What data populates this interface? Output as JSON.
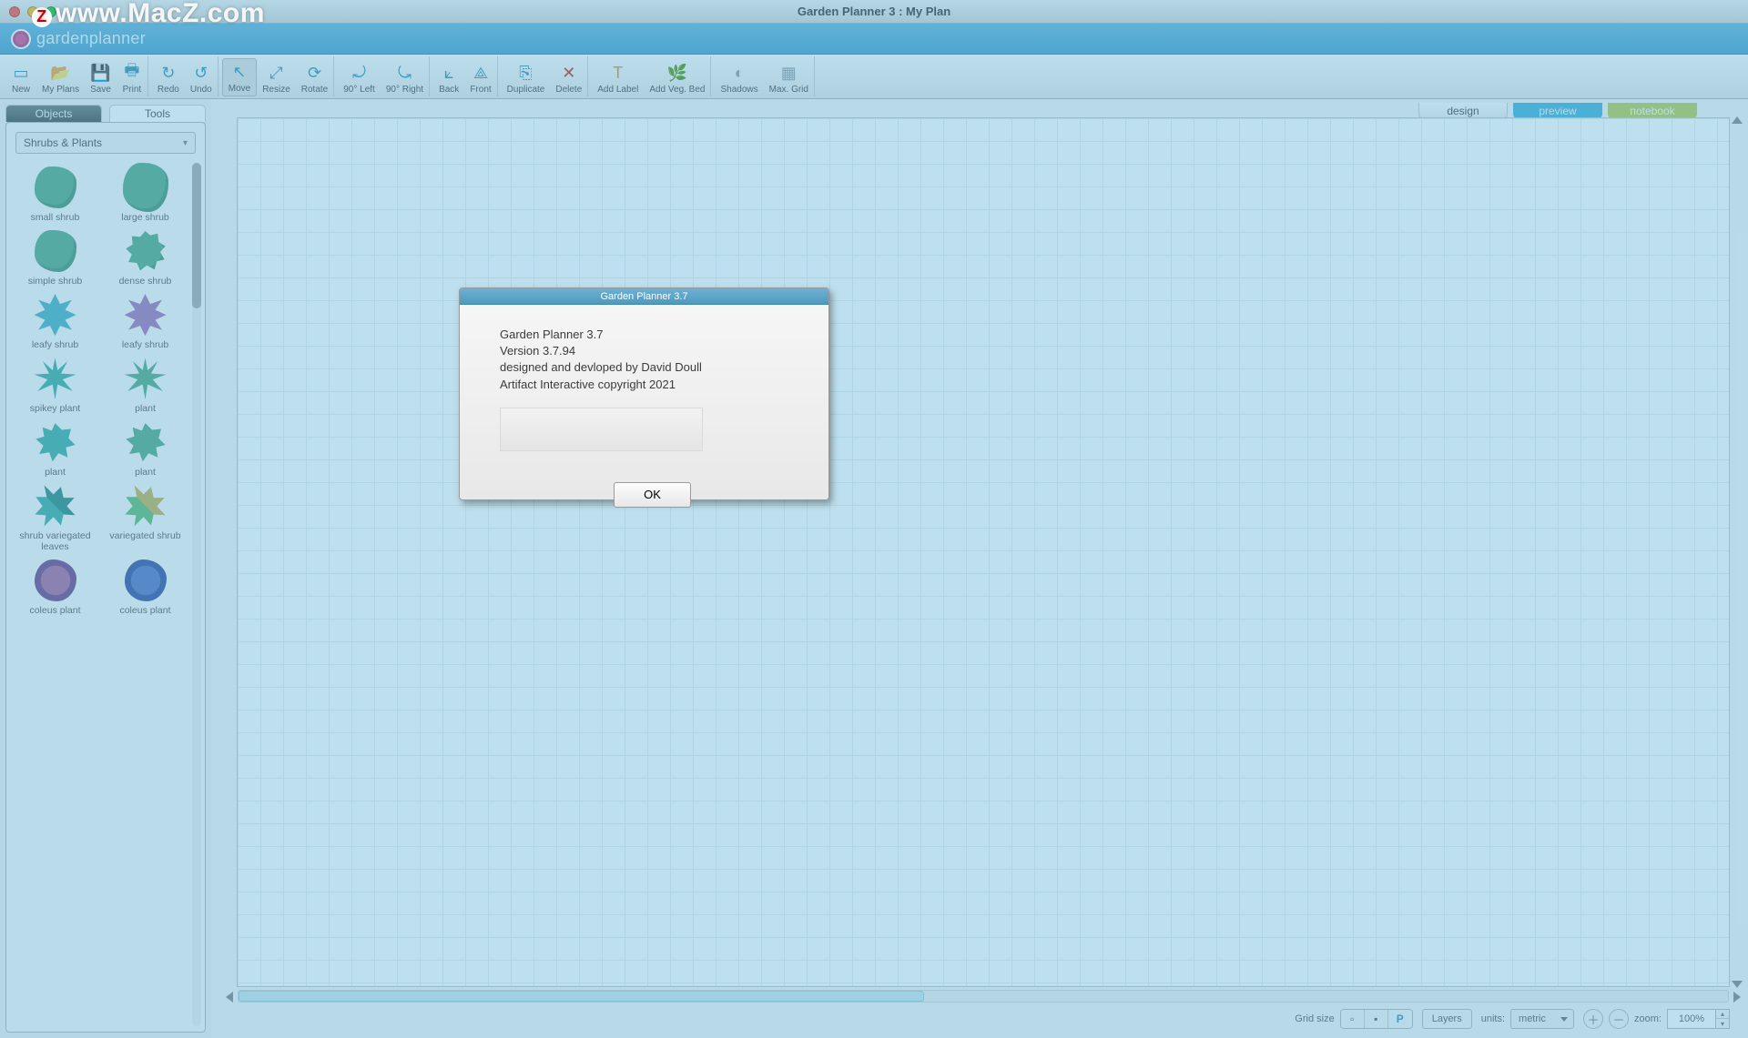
{
  "watermark": "www.MacZ.com",
  "window": {
    "title": "Garden Planner 3 : My  Plan"
  },
  "brand": {
    "name": "gardenplanner"
  },
  "toolbar": {
    "groups": [
      {
        "items": [
          {
            "id": "new",
            "label": "New",
            "icon": "▭"
          },
          {
            "id": "myplans",
            "label": "My Plans",
            "icon": "📂"
          },
          {
            "id": "save",
            "label": "Save",
            "icon": "💾"
          },
          {
            "id": "print",
            "label": "Print",
            "icon": "🖶"
          }
        ]
      },
      {
        "items": [
          {
            "id": "redo",
            "label": "Redo",
            "icon": "↻"
          },
          {
            "id": "undo",
            "label": "Undo",
            "icon": "↺"
          }
        ]
      },
      {
        "items": [
          {
            "id": "move",
            "label": "Move",
            "icon": "↖",
            "selected": true
          },
          {
            "id": "resize",
            "label": "Resize",
            "icon": "⤢"
          },
          {
            "id": "rotate",
            "label": "Rotate",
            "icon": "⟳"
          }
        ]
      },
      {
        "items": [
          {
            "id": "rot-left",
            "label": "90° Left",
            "icon": "⤾"
          },
          {
            "id": "rot-right",
            "label": "90° Right",
            "icon": "⤿"
          }
        ]
      },
      {
        "items": [
          {
            "id": "back",
            "label": "Back",
            "icon": "⟀"
          },
          {
            "id": "front",
            "label": "Front",
            "icon": "⟁"
          }
        ]
      },
      {
        "items": [
          {
            "id": "duplicate",
            "label": "Duplicate",
            "icon": "⎘"
          },
          {
            "id": "delete",
            "label": "Delete",
            "icon": "✕",
            "cls": "red"
          }
        ]
      },
      {
        "items": [
          {
            "id": "add-label",
            "label": "Add Label",
            "icon": "T",
            "cls": "orange"
          },
          {
            "id": "add-veg",
            "label": "Add Veg. Bed",
            "icon": "🌿",
            "cls": "green"
          }
        ]
      },
      {
        "items": [
          {
            "id": "shadows",
            "label": "Shadows",
            "icon": "◐",
            "cls": "grey"
          },
          {
            "id": "max-grid",
            "label": "Max. Grid",
            "icon": "▦",
            "cls": "grey"
          }
        ]
      }
    ]
  },
  "sidebar": {
    "tabs": {
      "objects": "Objects",
      "tools": "Tools",
      "active": "objects"
    },
    "category": "Shrubs & Plants",
    "plants": [
      {
        "label": "small shrub",
        "shape": "shrub"
      },
      {
        "label": "large shrub",
        "shape": "shrub big"
      },
      {
        "label": "simple shrub",
        "shape": "shrub"
      },
      {
        "label": "dense shrub",
        "shape": "dense"
      },
      {
        "label": "leafy shrub",
        "shape": "leafy"
      },
      {
        "label": "leafy shrub",
        "shape": "leafy purple"
      },
      {
        "label": "spikey plant",
        "shape": "spikey teal"
      },
      {
        "label": "plant",
        "shape": "spikey"
      },
      {
        "label": "plant",
        "shape": "rosette teal"
      },
      {
        "label": "plant",
        "shape": "rosette"
      },
      {
        "label": "shrub variegated leaves",
        "shape": "var"
      },
      {
        "label": "variegated shrub",
        "shape": "var gold"
      },
      {
        "label": "coleus plant",
        "shape": "coleus"
      },
      {
        "label": "coleus plant",
        "shape": "coleus blue"
      }
    ]
  },
  "viewtabs": {
    "design": "design",
    "preview": "preview",
    "notebook": "notebook",
    "active": "design"
  },
  "status": {
    "gridsize_label": "Grid size",
    "layers_label": "Layers",
    "units_label": "units:",
    "units_value": "metric",
    "zoom_label": "zoom:",
    "zoom_value": "100%"
  },
  "dialog": {
    "title": "Garden Planner 3.7",
    "lines": [
      "Garden Planner 3.7",
      "Version 3.7.94",
      "designed and devloped by David Doull",
      "Artifact Interactive copyright 2021"
    ],
    "ok": "OK"
  }
}
